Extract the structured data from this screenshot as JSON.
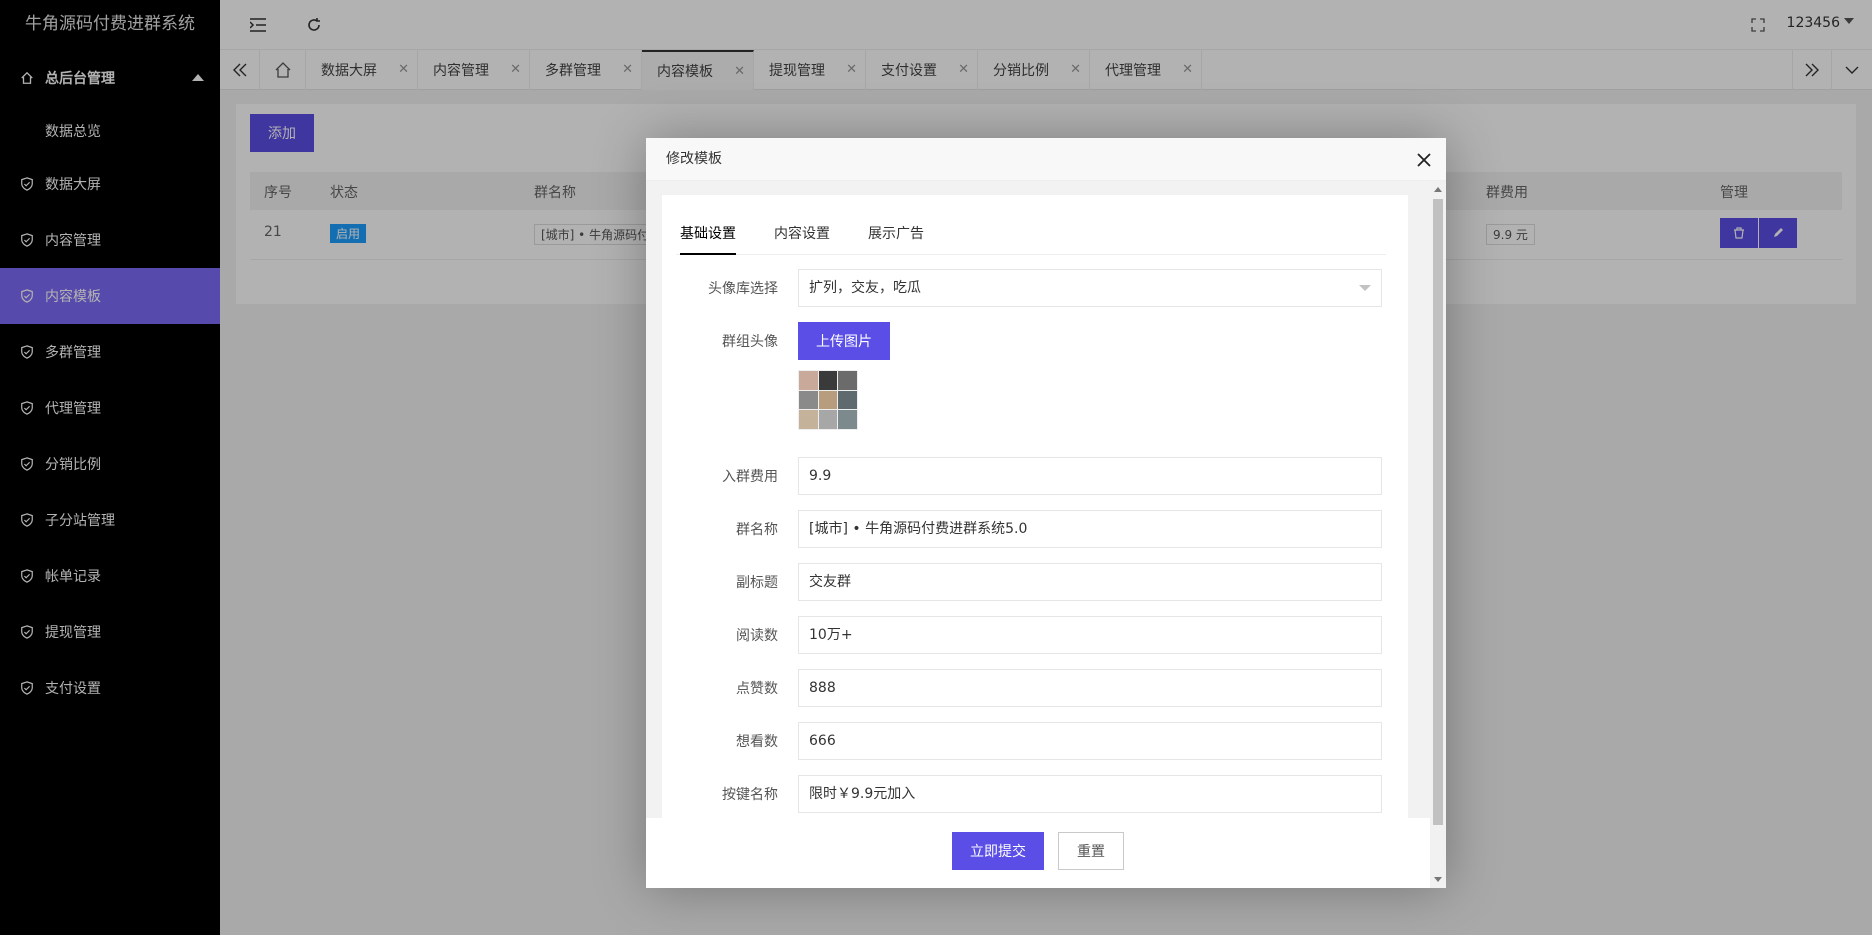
{
  "app": {
    "title": "牛角源码付费进群系统",
    "user": "123456"
  },
  "sidebar": {
    "parent": "总后台管理",
    "sub": "数据总览",
    "items": [
      {
        "label": "数据大屏"
      },
      {
        "label": "内容管理"
      },
      {
        "label": "内容模板",
        "active": true
      },
      {
        "label": "多群管理"
      },
      {
        "label": "代理管理"
      },
      {
        "label": "分销比例"
      },
      {
        "label": "子分站管理"
      },
      {
        "label": "帐单记录"
      },
      {
        "label": "提现管理"
      },
      {
        "label": "支付设置"
      }
    ]
  },
  "tabs": [
    {
      "label": "数据大屏"
    },
    {
      "label": "内容管理"
    },
    {
      "label": "多群管理"
    },
    {
      "label": "内容模板",
      "active": true
    },
    {
      "label": "提现管理"
    },
    {
      "label": "支付设置"
    },
    {
      "label": "分销比例"
    },
    {
      "label": "代理管理"
    }
  ],
  "page": {
    "add_label": "添加",
    "columns": {
      "id": "序号",
      "status": "状态",
      "name": "群名称",
      "fee": "群费用",
      "manage": "管理"
    },
    "row": {
      "id": "21",
      "status": "启用",
      "name": "[城市] • 牛角源码付费",
      "fee": "9.9 元"
    }
  },
  "modal": {
    "title": "修改模板",
    "tabs": [
      "基础设置",
      "内容设置",
      "展示广告"
    ],
    "fields": {
      "avatar_lib": {
        "label": "头像库选择",
        "value": "扩列，交友，吃瓜"
      },
      "group_avatar": {
        "label": "群组头像",
        "button": "上传图片"
      },
      "fee": {
        "label": "入群费用",
        "value": "9.9"
      },
      "group_name": {
        "label": "群名称",
        "value": "[城市] • 牛角源码付费进群系统5.0"
      },
      "subtitle": {
        "label": "副标题",
        "value": "交友群"
      },
      "reads": {
        "label": "阅读数",
        "value": "10万+"
      },
      "likes": {
        "label": "点赞数",
        "value": "888"
      },
      "wants": {
        "label": "想看数",
        "value": "666"
      },
      "button_name": {
        "label": "按键名称",
        "value": "限时￥9.9元加入"
      }
    },
    "submit_label": "立即提交",
    "reset_label": "重置"
  },
  "colors": {
    "accent": "#5b4ee6",
    "sidebar_active": "#7b6cf6",
    "sidebar_bg": "#000000",
    "badge": "#1e9fff"
  }
}
